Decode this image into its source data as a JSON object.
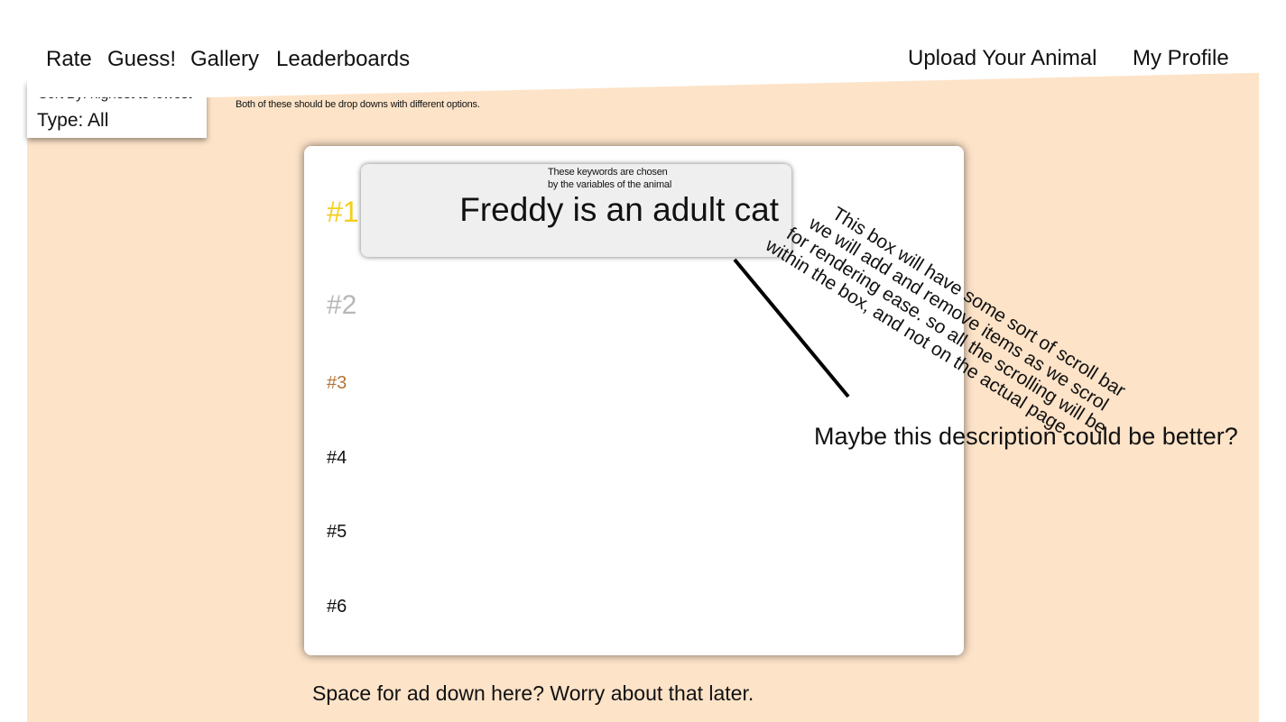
{
  "nav": {
    "left_links": [
      "Rate",
      "Guess!",
      "Gallery",
      "Leaderboards"
    ],
    "right_links": [
      "Upload Your Animal",
      "My Profile"
    ]
  },
  "filters": {
    "sort_by": "Sort By: highest to lowest",
    "type": "Type: All",
    "note": "Both of these should be drop downs with different options."
  },
  "leaderboard": {
    "ranks": [
      "#1",
      "#2",
      "#3",
      "#4",
      "#5",
      "#6"
    ],
    "rank_colors": [
      "#f3cf1d",
      "#b7b7b7",
      "#b4743a",
      "#111111",
      "#111111",
      "#111111"
    ],
    "description_card": {
      "keyword_note_line1": "These keywords are chosen",
      "keyword_note_line2": "by the variables of the animal",
      "text": "Freddy is an adult cat"
    }
  },
  "annotations": {
    "scroll_note_lines": [
      "This box will have some sort of scroll bar",
      "we will add and remove items as we scrol",
      "for rendering ease. so all the scrolling will be",
      "within the box, and not on the actual page."
    ],
    "description_note": "Maybe this description could be better?",
    "ad_note": "Space for ad down here? Worry about that later."
  },
  "colors": {
    "background": "#fde3c8",
    "panel": "#ffffff",
    "card": "#efefef"
  }
}
